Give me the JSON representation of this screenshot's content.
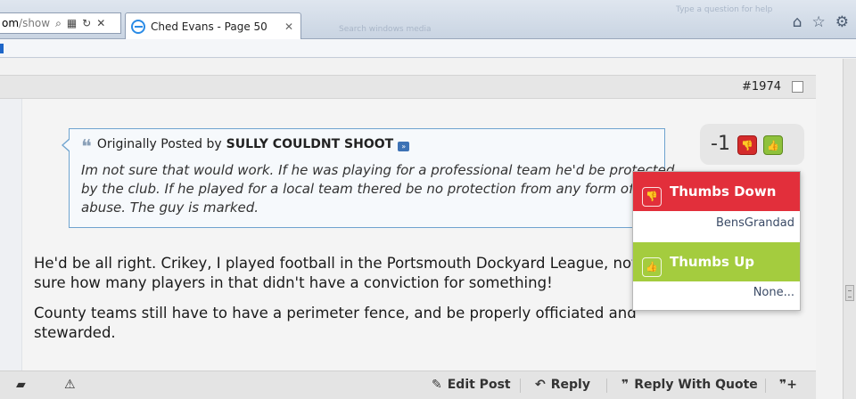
{
  "browser": {
    "address": {
      "host": "om",
      "rest": "/show"
    },
    "tab_title": "Ched Evans - Page 50",
    "ghost_left": "Search windows media",
    "ghost_right": "Type a question for help"
  },
  "post": {
    "number": "#1974",
    "quote": {
      "prefix": "Originally Posted by",
      "author": "SULLY COULDNT SHOOT",
      "lines": [
        "Im not sure that would work. If he was playing for a professional team he'd be protected",
        "by the club. If he played for a local team thered be no protection from any form of",
        "abuse. The guy is marked."
      ]
    },
    "message": [
      "He'd be all right. Crikey, I played football in the Portsmouth Dockyard League, not",
      "sure how many players in that didn't have a conviction for something!",
      "County teams still have to have a perimeter fence, and be properly officiated and",
      "stewarded."
    ],
    "rating": {
      "score": "-1"
    },
    "rating_popup": {
      "down_label": "Thumbs Down",
      "down_names": "BensGrandad",
      "up_label": "Thumbs Up",
      "up_names": "None..."
    },
    "footer": {
      "edit": "Edit Post",
      "reply": "Reply",
      "reply_quote": "Reply With Quote"
    }
  },
  "colors": {
    "thumbs_down": "#e22f3b",
    "thumbs_up": "#a4cc3e",
    "quote_border": "#6fa3cf"
  }
}
